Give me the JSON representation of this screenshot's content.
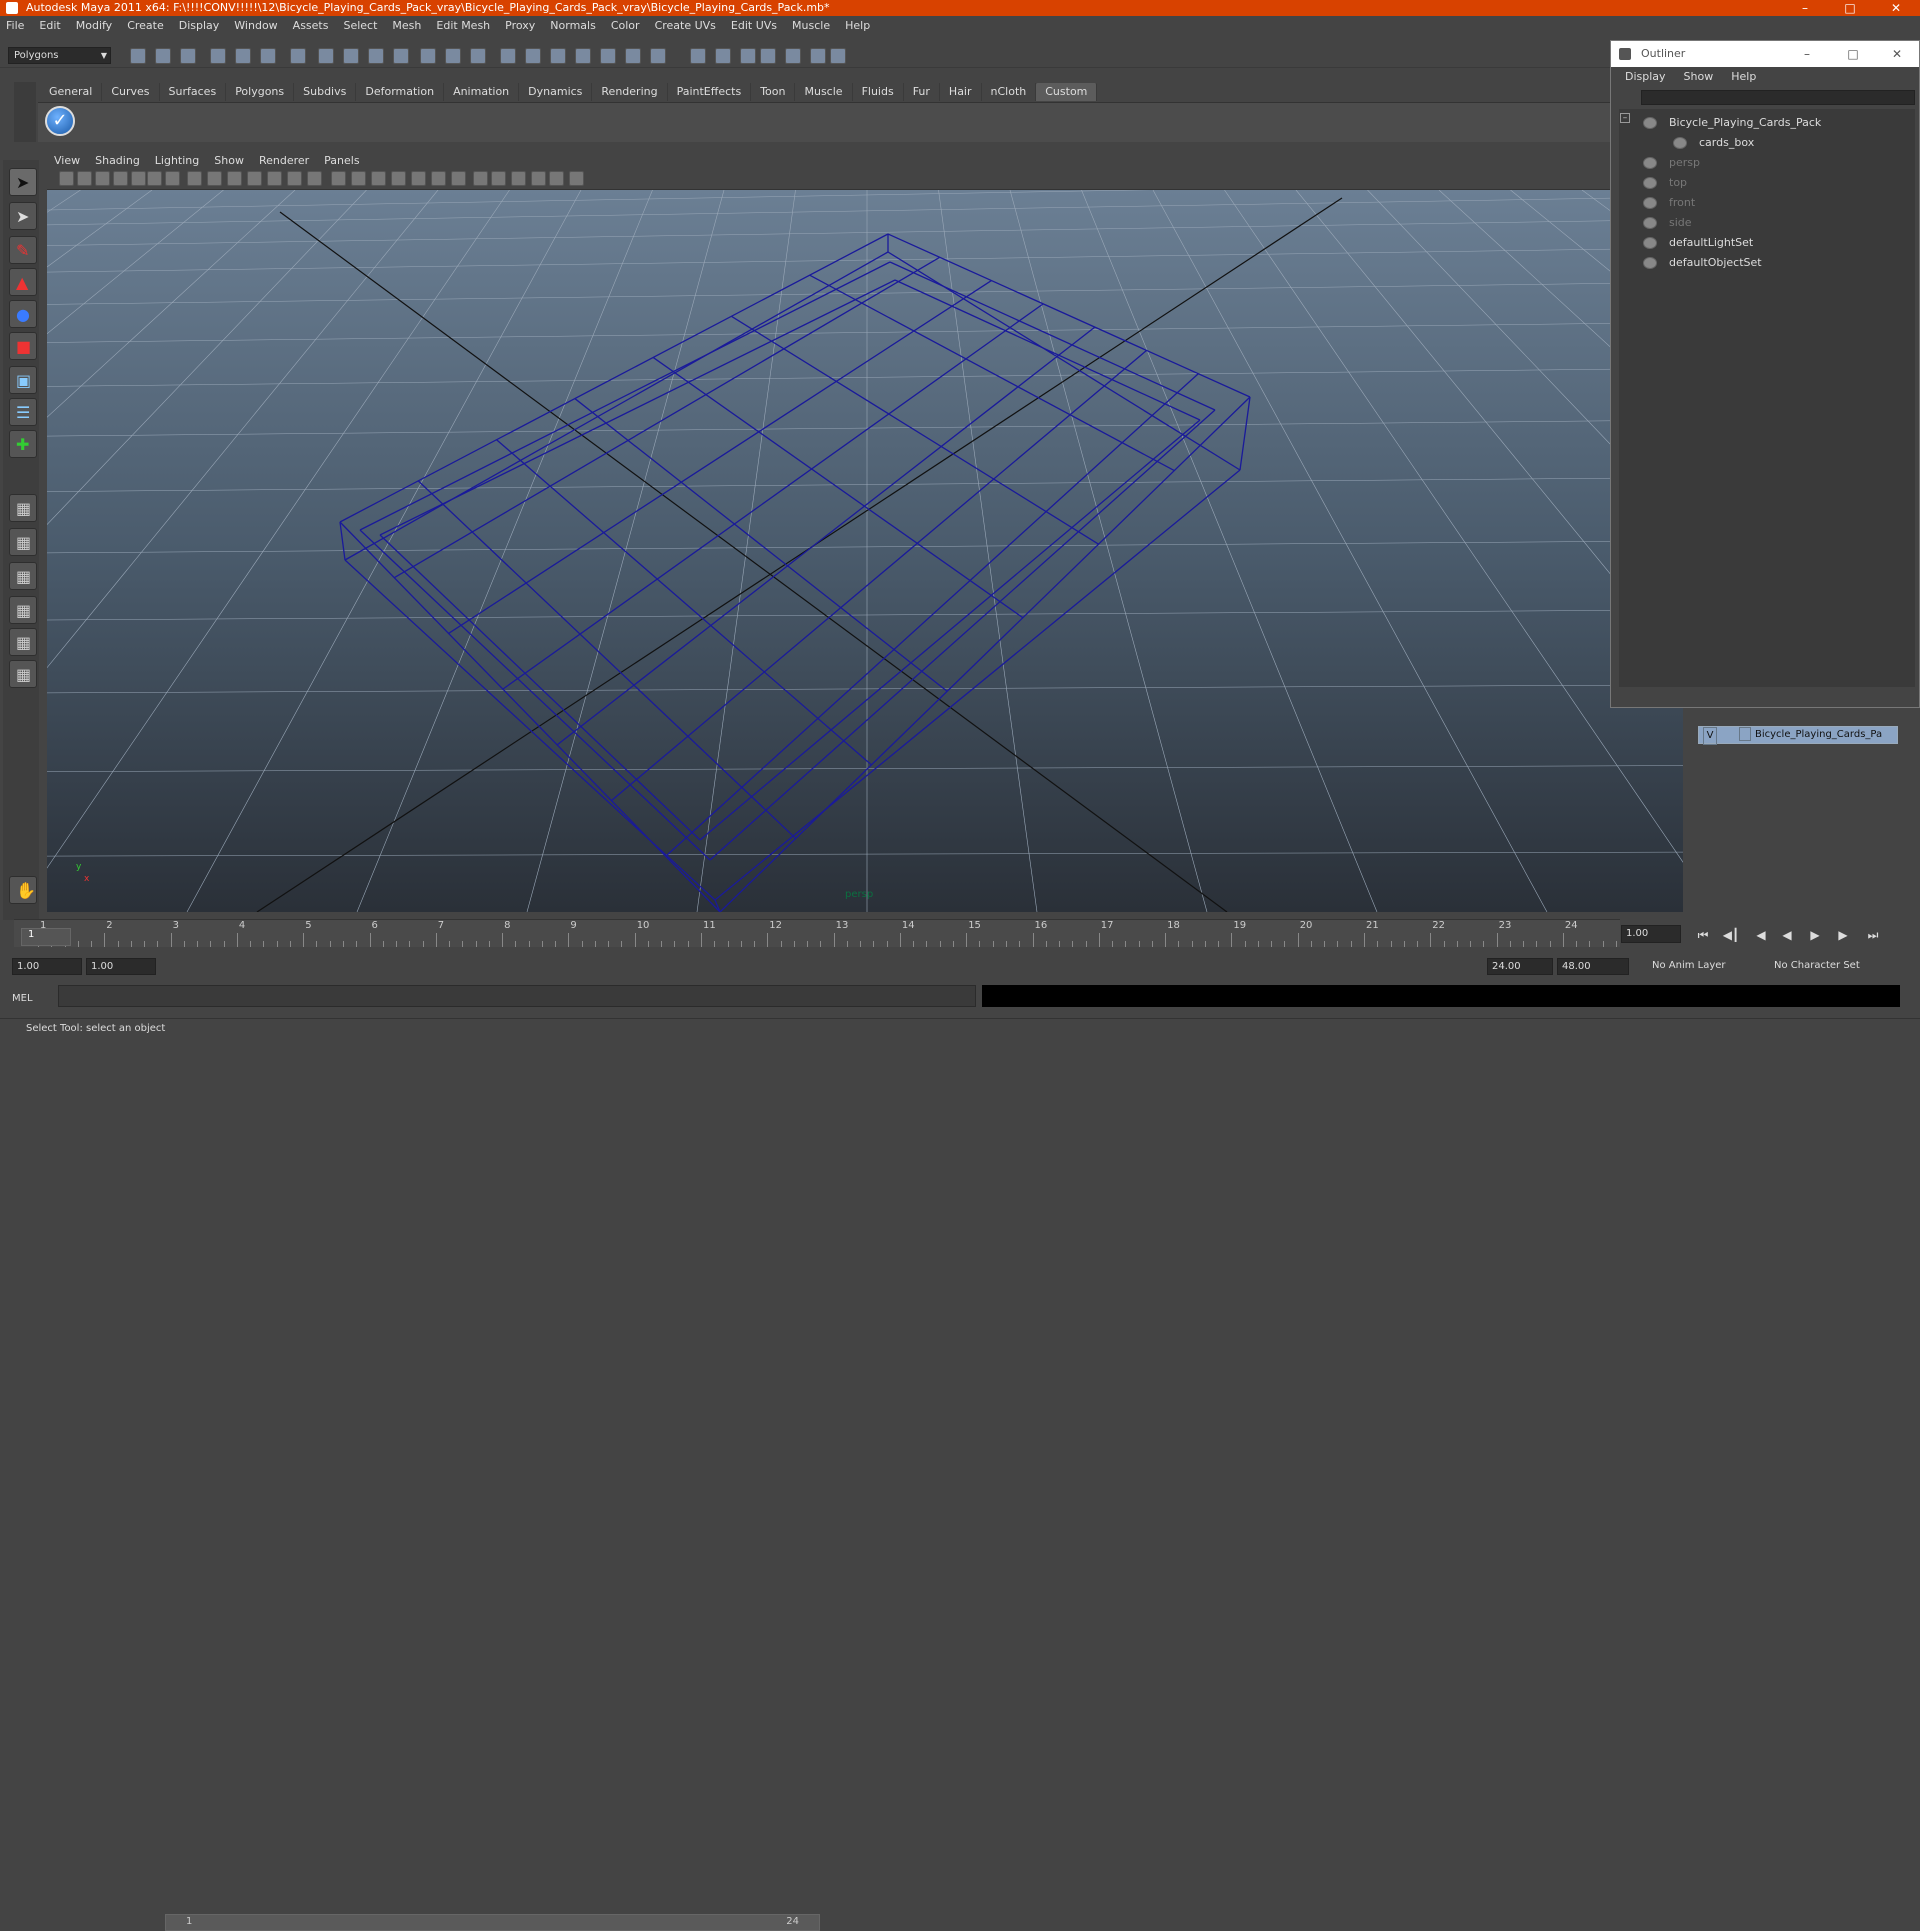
{
  "window": {
    "title": "Autodesk Maya 2011 x64: F:\\!!!!CONV!!!!!\\12\\Bicycle_Playing_Cards_Pack_vray\\Bicycle_Playing_Cards_Pack_vray\\Bicycle_Playing_Cards_Pack.mb*"
  },
  "menubar": [
    "File",
    "Edit",
    "Modify",
    "Create",
    "Display",
    "Window",
    "Assets",
    "Select",
    "Mesh",
    "Edit Mesh",
    "Proxy",
    "Normals",
    "Color",
    "Create UVs",
    "Edit UVs",
    "Muscle",
    "Help"
  ],
  "mode": "Polygons",
  "shelf_tabs": [
    "General",
    "Curves",
    "Surfaces",
    "Polygons",
    "Subdivs",
    "Deformation",
    "Animation",
    "Dynamics",
    "Rendering",
    "PaintEffects",
    "Toon",
    "Muscle",
    "Fluids",
    "Fur",
    "Hair",
    "nCloth",
    "Custom"
  ],
  "shelf_active": "Custom",
  "viewport": {
    "menu": [
      "View",
      "Shading",
      "Lighting",
      "Show",
      "Renderer",
      "Panels"
    ],
    "camera_label": "persp",
    "axis_y": "y",
    "axis_x": "x"
  },
  "outliner": {
    "title": "Outliner",
    "menu": [
      "Display",
      "Show",
      "Help"
    ],
    "items": [
      {
        "label": "Bicycle_Playing_Cards_Pack",
        "dim": false
      },
      {
        "label": "cards_box",
        "dim": false
      },
      {
        "label": "persp",
        "dim": true
      },
      {
        "label": "top",
        "dim": true
      },
      {
        "label": "front",
        "dim": true
      },
      {
        "label": "side",
        "dim": true
      },
      {
        "label": "defaultLightSet",
        "dim": false
      },
      {
        "label": "defaultObjectSet",
        "dim": false
      }
    ]
  },
  "layers": {
    "visible": "V",
    "name": "Bicycle_Playing_Cards_Pa"
  },
  "timeline": {
    "ticks": [
      "1",
      "2",
      "3",
      "4",
      "5",
      "6",
      "7",
      "8",
      "9",
      "10",
      "11",
      "12",
      "13",
      "14",
      "15",
      "16",
      "17",
      "18",
      "19",
      "20",
      "21",
      "22",
      "23",
      "24"
    ],
    "current_frame": "1",
    "current_field": "1.00"
  },
  "range": {
    "start": "1.00",
    "start_inner": "1.00",
    "slider_start": "1",
    "slider_end": "24",
    "end_inner": "24.00",
    "end": "48.00",
    "anim_layer": "No Anim Layer",
    "char_set": "No Character Set"
  },
  "command": {
    "label": "MEL"
  },
  "help": {
    "text": "Select Tool: select an object"
  },
  "colors": {
    "titlebar": "#d84200",
    "wireframe": "#1a1a9a",
    "grid": "#9aa8b8"
  }
}
